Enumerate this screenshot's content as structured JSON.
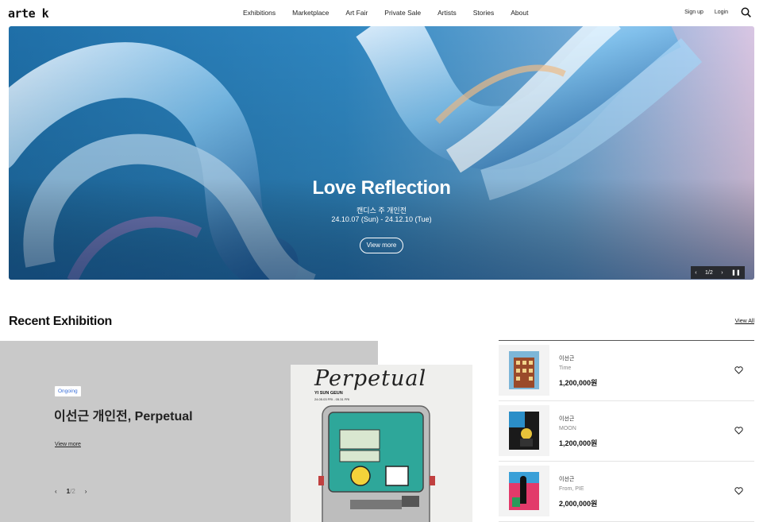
{
  "header": {
    "logo": "arte k",
    "nav": [
      "Exhibitions",
      "Marketplace",
      "Art Fair",
      "Private Sale",
      "Artists",
      "Stories",
      "About"
    ],
    "signup": "Sign up",
    "login": "Login"
  },
  "hero": {
    "title": "Love Reflection",
    "subtitle": "캔디스 주 개인전",
    "dates": "24.10.07 (Sun) - 24.12.10 (Tue)",
    "button": "View more",
    "pager": "1/2"
  },
  "recent": {
    "title": "Recent Exhibition",
    "view_all": "View All",
    "feature": {
      "badge": "Ongoing",
      "title": "이선근 개인전, Perpetual",
      "link": "View more",
      "pager_current": "1",
      "pager_total": "/2"
    },
    "poster": {
      "title": "Perpetual",
      "artist": "YI SUN GEUN",
      "dates": "24.05.03 FRI - 05.31 FRI"
    },
    "items": [
      {
        "artist": "이선근",
        "work": "Time",
        "price": "1,200,000원"
      },
      {
        "artist": "이선근",
        "work": "MOON",
        "price": "1,200,000원"
      },
      {
        "artist": "이선근",
        "work": "From, PIE",
        "price": "2,000,000원"
      }
    ]
  }
}
